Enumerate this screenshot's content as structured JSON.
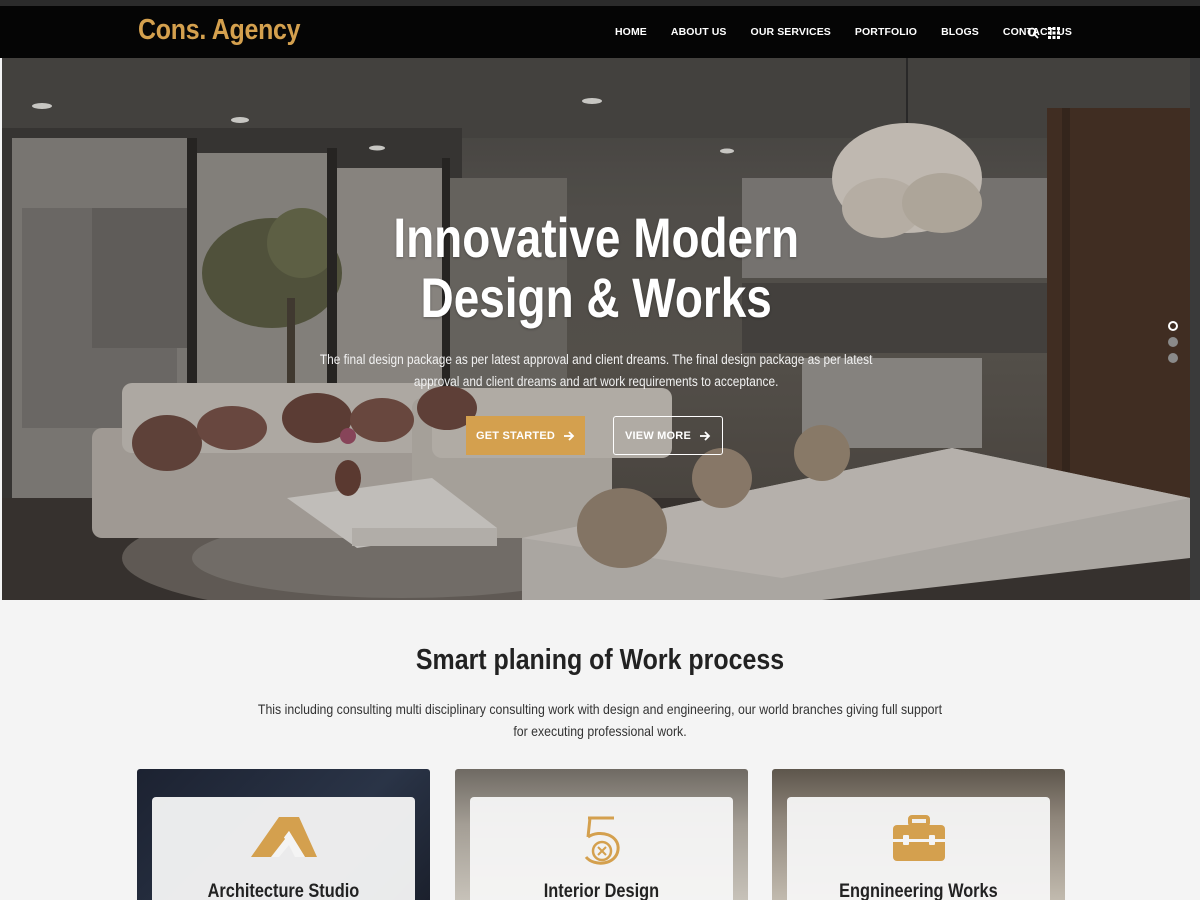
{
  "brand": {
    "logo": "Cons. Agency",
    "accent_color": "#d4a04e"
  },
  "nav": {
    "items": [
      {
        "label": "HOME"
      },
      {
        "label": "ABOUT US"
      },
      {
        "label": "OUR SERVICES"
      },
      {
        "label": "PORTFOLIO"
      },
      {
        "label": "BLOGS"
      },
      {
        "label": "CONTACT US"
      }
    ],
    "icons": [
      "search-icon",
      "grid-menu-icon"
    ]
  },
  "hero": {
    "title_line1": "Innovative Modern",
    "title_line2": "Design & Works",
    "subtitle_line1": "The final design package as per latest approval and client dreams. The final design package as per latest",
    "subtitle_line2": "approval and client dreams and art work requirements to acceptance.",
    "primary_button": "GET STARTED",
    "secondary_button": "VIEW MORE",
    "slider_dots": 3,
    "active_slide": 1
  },
  "process": {
    "title": "Smart planing of Work process",
    "desc_line1": "This including consulting multi disciplinary consulting work with design and engineering, our world branches giving full support",
    "desc_line2": "for executing professional work.",
    "cards": [
      {
        "label": "Architecture Studio",
        "icon": "architecture-icon"
      },
      {
        "label": "Interior Design",
        "icon": "interior-design-icon"
      },
      {
        "label": "Engnineering Works",
        "icon": "briefcase-icon"
      }
    ]
  }
}
